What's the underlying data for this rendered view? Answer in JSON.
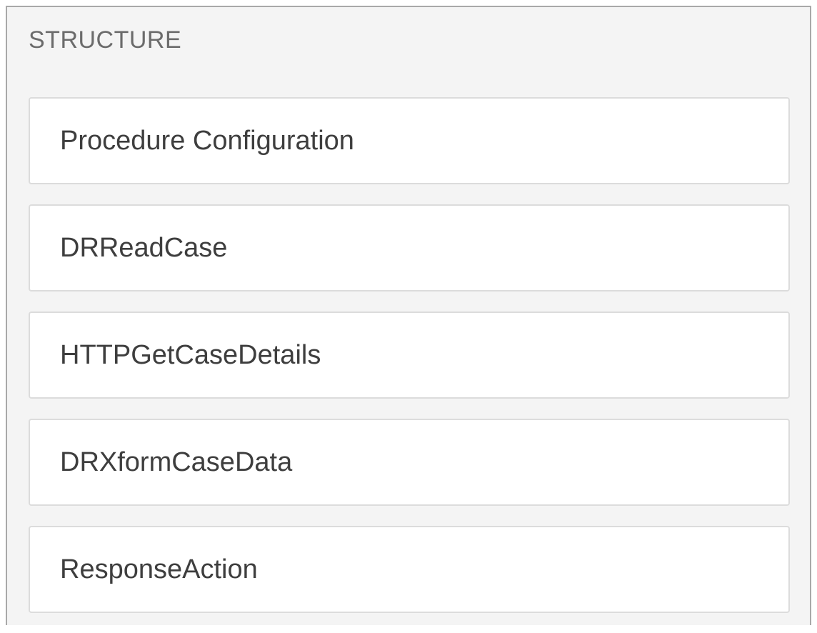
{
  "panel": {
    "title": "STRUCTURE",
    "items": [
      {
        "label": "Procedure Configuration"
      },
      {
        "label": "DRReadCase"
      },
      {
        "label": "HTTPGetCaseDetails"
      },
      {
        "label": "DRXformCaseData"
      },
      {
        "label": "ResponseAction"
      }
    ]
  },
  "colors": {
    "panel_background": "#f4f4f4",
    "panel_border": "#a9a9a9",
    "item_background": "#ffffff",
    "item_border": "#dcdcdc",
    "title_text": "#6b6b6b",
    "item_text": "#3e3e3e"
  }
}
